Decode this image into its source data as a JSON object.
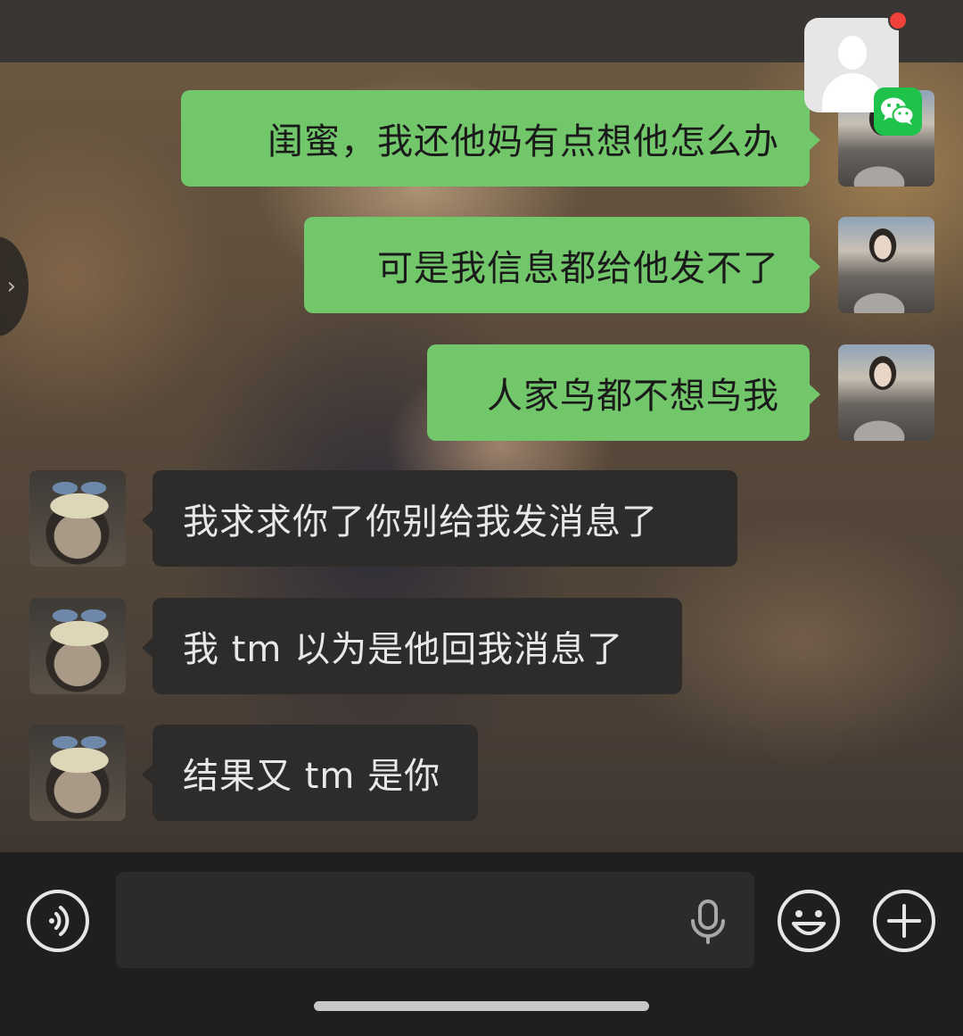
{
  "messages": [
    {
      "side": "out",
      "text": "闺蜜，我还他妈有点想他怎么办"
    },
    {
      "side": "out",
      "text": "可是我信息都给他发不了"
    },
    {
      "side": "out",
      "text": "人家鸟都不想鸟我"
    },
    {
      "side": "in",
      "text": "我求求你了你别给我发消息了"
    },
    {
      "side": "in",
      "text": "我 tm 以为是他回我消息了"
    },
    {
      "side": "in",
      "text": "结果又 tm 是你"
    }
  ],
  "input": {
    "placeholder": ""
  },
  "icons": {
    "voice": "voice-toggle-icon",
    "mic": "microphone-icon",
    "emoji": "emoji-icon",
    "plus": "plus-icon",
    "floating": "wechat-icon"
  },
  "colors": {
    "outgoing_bubble": "#72c76b",
    "incoming_bubble": "#2e2c2b",
    "notification_dot": "#f0413b",
    "wechat_green": "#1fc24a"
  }
}
